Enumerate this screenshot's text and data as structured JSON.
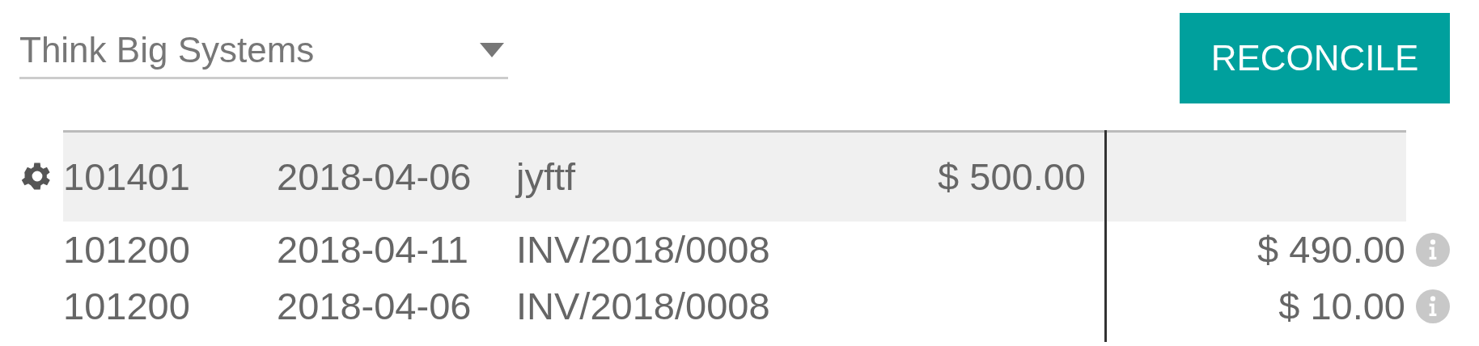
{
  "partner_select": {
    "value": "Think Big Systems"
  },
  "reconcile_button": {
    "label": "RECONCILE"
  },
  "lines": [
    {
      "kind": "open",
      "account": "101401",
      "date": "2018-04-06",
      "label": "jyftf",
      "debit": "$ 500.00"
    },
    {
      "kind": "match",
      "account": "101200",
      "date": "2018-04-11",
      "label": "INV/2018/0008",
      "credit": "$ 490.00"
    },
    {
      "kind": "match",
      "account": "101200",
      "date": "2018-04-06",
      "label": "INV/2018/0008",
      "credit": "$ 10.00"
    }
  ]
}
